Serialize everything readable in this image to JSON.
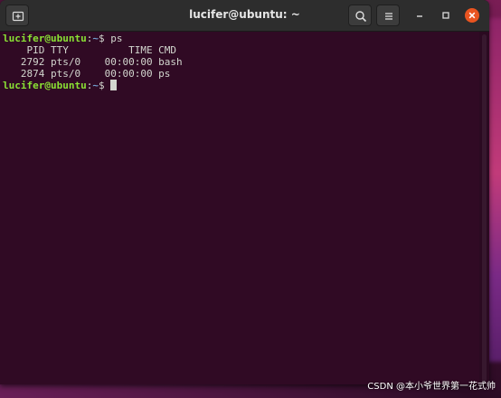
{
  "window": {
    "title": "lucifer@ubuntu: ~"
  },
  "icons": {
    "new_tab": "new-tab-icon",
    "search": "search-icon",
    "menu": "hamburger-menu-icon",
    "minimize": "minimize-icon",
    "maximize": "maximize-icon",
    "close": "close-icon"
  },
  "colors": {
    "terminal_bg": "#300a24",
    "prompt_user": "#8ae234",
    "prompt_path": "#729fcf",
    "text": "#d3d7cf",
    "close_button": "#e95420"
  },
  "terminal": {
    "prompt1": {
      "user": "lucifer@ubuntu",
      "sep": ":",
      "path": "~",
      "symbol": "$ ",
      "command": "ps"
    },
    "header": "    PID TTY          TIME CMD",
    "rows": [
      "   2792 pts/0    00:00:00 bash",
      "   2874 pts/0    00:00:00 ps"
    ],
    "prompt2": {
      "user": "lucifer@ubuntu",
      "sep": ":",
      "path": "~",
      "symbol": "$ "
    }
  },
  "watermark": "CSDN @本小爷世界第一花式帅"
}
